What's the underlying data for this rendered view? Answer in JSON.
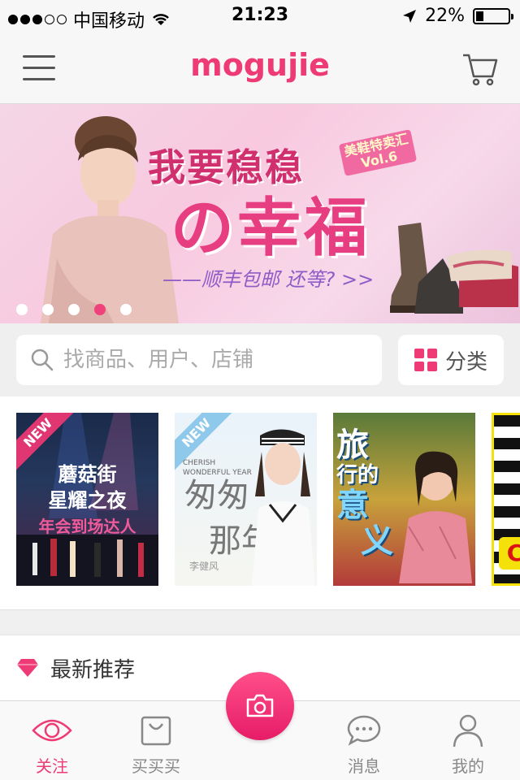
{
  "status_bar": {
    "carrier": "中国移动",
    "time": "21:23",
    "battery": "22%",
    "signal_dots_filled": 3,
    "signal_dots_total": 5,
    "battery_level": 0.22
  },
  "header": {
    "logo": "mogujie",
    "menu_icon": "menu-icon",
    "cart_icon": "cart-icon",
    "brand_color": "#ee3b75"
  },
  "banner": {
    "tag": "美鞋特卖汇 Vol.6",
    "line1": "我要稳稳",
    "line2": "の幸福",
    "line3": "——顺丰包邮 还等? >>",
    "dots_total": 5,
    "active_dot_index": 3
  },
  "search": {
    "placeholder": "找商品、用户、店铺",
    "category_label": "分类"
  },
  "topics": [
    {
      "badge": "NEW",
      "title_lines": [
        "蘑菇街",
        "星耀之夜",
        "年会到场达人"
      ]
    },
    {
      "badge": "NEW",
      "subtitle": "CHERISH WONDERFUL YEAR",
      "title_lines": [
        "匆匆",
        "那年"
      ],
      "signature": "李健风"
    },
    {
      "title_lines": [
        "旅",
        "行的",
        "意",
        "义"
      ]
    },
    {
      "title_lines": [
        "C"
      ]
    }
  ],
  "section": {
    "title": "最新推荐",
    "icon": "gem-icon"
  },
  "tabbar": {
    "items": [
      {
        "label": "关注",
        "icon": "eye-icon",
        "active": true
      },
      {
        "label": "买买买",
        "icon": "shopping-bag-icon",
        "active": false
      },
      {
        "label": "",
        "icon": "camera-icon",
        "active": false
      },
      {
        "label": "消息",
        "icon": "chat-icon",
        "active": false
      },
      {
        "label": "我的",
        "icon": "person-icon",
        "active": false
      }
    ]
  }
}
